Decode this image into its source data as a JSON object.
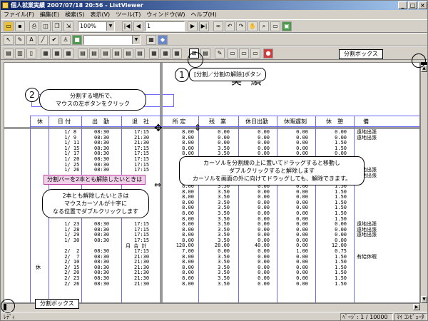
{
  "window": {
    "title": "個人就業実績 2007/07/18 20:56 - ListViewer",
    "min_label": "_",
    "max_label": "□",
    "close_label": "×"
  },
  "menu": [
    "ファイル(F)",
    "編集(E)",
    "検索(S)",
    "表示(V)",
    "ツール(T)",
    "ウィンドウ(W)",
    "ヘルプ(H)"
  ],
  "toolbar": {
    "zoom_value": "100%",
    "page_value": "1"
  },
  "document": {
    "title": "実 績",
    "headers": [
      "休",
      "日 付",
      "出　勤",
      "退　社",
      "所 定",
      "残　業",
      "休日出勤",
      "休暇遅刻",
      "休　憩",
      "備"
    ],
    "rest_col": "\n\n\n\n\n\n\n\n\n\n\n\n\n\n\n\n\n\n\n\n\n\n\n\n\n休",
    "date_col": " 1/ 8\n 1/ 9\n 1/ 11\n 1/ 15\n 1/ 17\n 1/ 20\n 1/ 25\n 1/ 26\n\n\n\n\n\n\n\n\n\n 1/ 23\n 1/ 28\n 1/ 29\n 1/ 30\n\n 2/  2\n 2/  7\n 2/ 10\n 2/ 15\n 2/ 20\n 2/ 23\n 2/ 26",
    "in_col": "08:30\n08:30\n08:30\n08:30\n08:30\n08:30\n08:30\n08:30\n\n\n\n\n\n\n\n\n\n08:30\n08:30\n08:30\n08:30\n\n08:30\n08:30\n08:30\n08:30\n08:30\n08:30\n08:30",
    "out_col": "17:15\n21:30\n21:30\n17:15\n17:15\n17:15\n17:15\n17:15\n\n\n\n\n\n\n\n\n\n17:15\n17:15\n17:15\n17:15\n\n17:15\n21:30\n21:30\n21:30\n21:30\n21:30\n21:30",
    "total_label": "月 合 計",
    "fixed_col": "8.00\n8.00\n8.00\n8.00\n8.00\n8.00\n8.00\n8.00\n8.00\n8.00\n8.00\n8.00\n8.00\n8.00\n8.00\n8.00\n8.00\n8.00\n8.00\n8.00\n8.00\n128.00\n7.00\n8.00\n8.00\n8.00\n8.00\n8.00\n8.00",
    "ot_col": "0.00\n0.00\n0.00\n3.50\n3.50\n3.50\n3.50\n3.50\n3.50\n3.50\n3.50\n3.50\n3.50\n3.50\n3.50\n3.50\n3.50\n3.50\n3.50\n3.50\n3.50\n28.00\n0.00\n3.50\n3.50\n3.50\n3.50\n3.50\n3.50",
    "holiday_col": "0.00\n0.00\n0.00\n0.00\n0.00\n0.00\n0.00\n0.00\n0.00\n0.00\n0.00\n0.00\n0.00\n0.00\n0.00\n0.00\n0.00\n0.00\n0.00\n0.00\n0.00\n40.00\n0.00\n0.00\n0.00\n0.00\n0.00\n0.00\n0.00",
    "late_col": "0.00\n0.00\n0.00\n0.00\n0.00\n0.00\n0.00\n0.00\n0.00\n0.00\n0.00\n0.00\n0.00\n0.00\n0.00\n0.00\n0.00\n0.00\n0.00\n0.00\n0.00\n0.00\n1.00\n0.00\n0.00\n0.00\n0.00\n0.00\n0.00",
    "break_col": "0.00\n0.00\n1.50\n1.50\n0.00\n0.00\n0.00\n0.00\n1.50\n1.50\n1.50\n1.50\n1.50\n1.50\n1.50\n1.50\n1.50\n0.00\n0.00\n0.00\n0.00\n12.00\n0.75\n1.50\n1.50\n1.50\n1.50\n1.50\n1.50",
    "note_col": "遠地出張\n遠地出張\n\n\n\n\n\n遠地出張\n遠地出張\n\n\n\n\n\n\n\n\n遠地出張\n遠地出張\n遠地出張\n\n\n\n有給休暇"
  },
  "annotations": {
    "split_box_top": "分割ボックス",
    "split_box_bottom": "分割ボックス",
    "step1_num": "1",
    "step1_text": "[分割／分割の解除]ボタン",
    "step2_num": "2",
    "step2_text": "分割する場所で、\nマウスの左ボタンをクリック",
    "drag_text": "カーソルを分割線の上に置いてドラッグすると移動し\nダブルクリックすると解除します\nカーソルを画面の外に向けてドラッグしても、解除できます。",
    "pink_label": "分割バーを2本とも解除したいときは",
    "both_text": "2本とも解除したいときは\nマウスカーソルが十字に\nなる位置でダブルクリックします"
  },
  "status": {
    "ready": "ﾚﾃﾞｨ",
    "page": "ﾍﾟｰｼﾞ: 1 / 10000",
    "computer": "ﾏｲ ｺﾝﾋﾟｭｰﾀ"
  }
}
